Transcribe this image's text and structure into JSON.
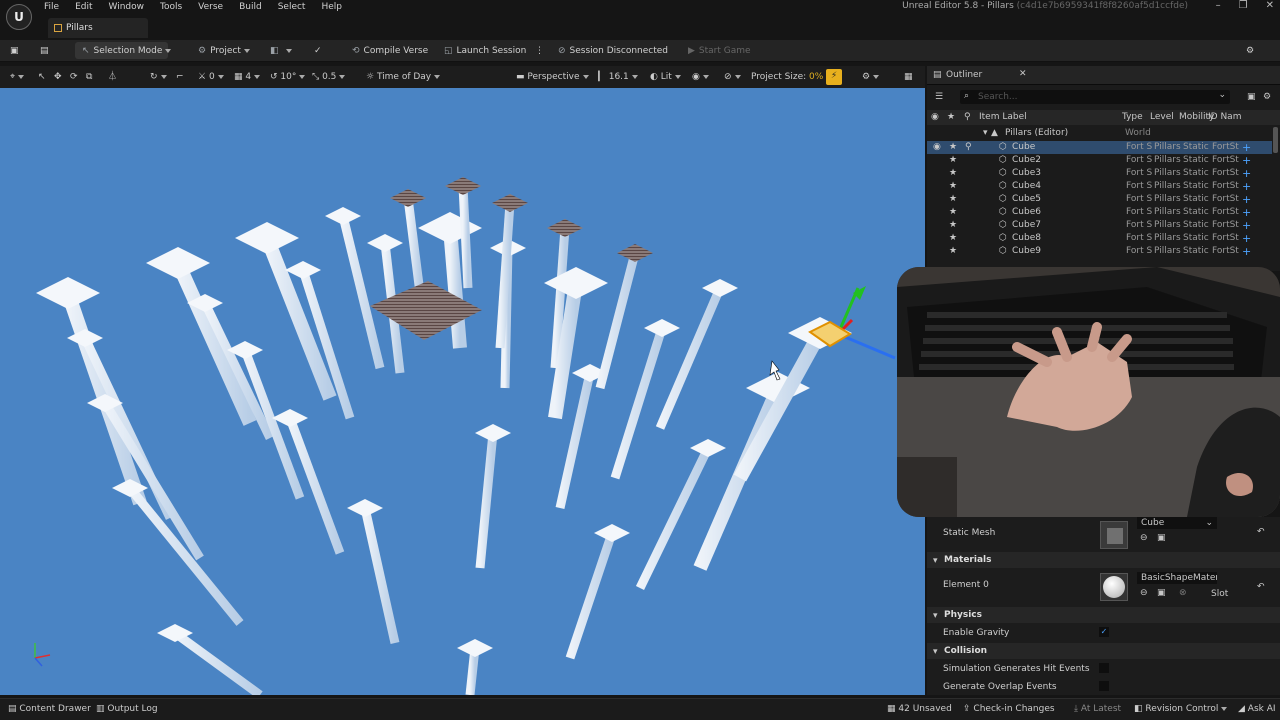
{
  "window": {
    "title": "Unreal Editor 5.8 - Pillars",
    "hash": "(c4d1e7b6959341f8f8260af5d1ccfde)",
    "logo": "U"
  },
  "menu": [
    "File",
    "Edit",
    "Window",
    "Tools",
    "Verse",
    "Build",
    "Select",
    "Help"
  ],
  "doc_tab": "Pillars",
  "toolbar": {
    "mode": "Selection Mode",
    "project": "Project",
    "compile": "Compile Verse",
    "launch": "Launch Session",
    "session": "Session Disconnected",
    "start": "Start Game"
  },
  "viewport_bar": {
    "snap_loc": "0",
    "snap_rot": "4",
    "angle": "10°",
    "scale": "0.5",
    "time": "Time of Day",
    "perspective": "Perspective",
    "fov": "16.1",
    "lit": "Lit",
    "project_size_label": "Project Size:",
    "project_size_value": "0%"
  },
  "outliner": {
    "tab": "Outliner",
    "search_placeholder": "Search...",
    "columns": [
      "Item Label",
      "Type",
      "Level",
      "Mobility",
      "ID Nam"
    ],
    "root": {
      "label": "Pillars (Editor)",
      "type": "World"
    },
    "rows": [
      {
        "label": "Cube",
        "type": "Fort S",
        "level": "Pillars",
        "mobility": "Static",
        "id": "FortSt",
        "selected": true
      },
      {
        "label": "Cube2",
        "type": "Fort S",
        "level": "Pillars",
        "mobility": "Static",
        "id": "FortSt"
      },
      {
        "label": "Cube3",
        "type": "Fort S",
        "level": "Pillars",
        "mobility": "Static",
        "id": "FortSt"
      },
      {
        "label": "Cube4",
        "type": "Fort S",
        "level": "Pillars",
        "mobility": "Static",
        "id": "FortSt"
      },
      {
        "label": "Cube5",
        "type": "Fort S",
        "level": "Pillars",
        "mobility": "Static",
        "id": "FortSt"
      },
      {
        "label": "Cube6",
        "type": "Fort S",
        "level": "Pillars",
        "mobility": "Static",
        "id": "FortSt"
      },
      {
        "label": "Cube7",
        "type": "Fort S",
        "level": "Pillars",
        "mobility": "Static",
        "id": "FortSt"
      },
      {
        "label": "Cube8",
        "type": "Fort S",
        "level": "Pillars",
        "mobility": "Static",
        "id": "FortSt"
      },
      {
        "label": "Cube9",
        "type": "Fort S",
        "level": "Pillars",
        "mobility": "Static",
        "id": "FortSt"
      }
    ]
  },
  "details": {
    "static_mesh_label": "Static Mesh",
    "static_mesh_value": "Cube",
    "materials_section": "Materials",
    "element0_label": "Element 0",
    "element0_value": "BasicShapeMater",
    "slot": "Slot",
    "physics_section": "Physics",
    "gravity_label": "Enable Gravity",
    "collision_section": "Collision",
    "hit_events": "Simulation Generates Hit Events",
    "overlap_events": "Generate Overlap Events"
  },
  "status": {
    "content_drawer": "Content Drawer",
    "output_log": "Output Log",
    "unsaved": "42 Unsaved",
    "checkin": "Check-in Changes",
    "at_latest": "At Latest",
    "revision": "Revision Control",
    "ask_ai": "Ask AI"
  }
}
